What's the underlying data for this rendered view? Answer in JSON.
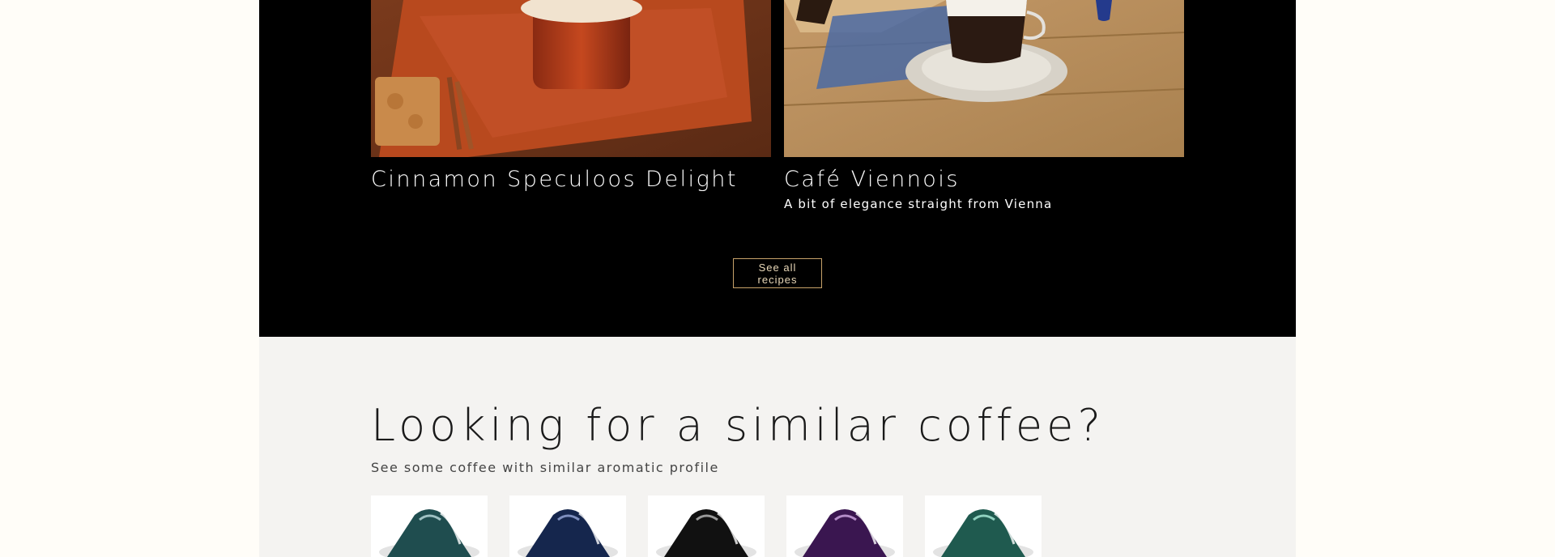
{
  "recipes": {
    "items": [
      {
        "title": "Cinnamon Speculoos Delight",
        "subtitle": ""
      },
      {
        "title": "Café Viennois",
        "subtitle": "A bit of elegance straight from Vienna"
      }
    ],
    "see_all_label": "See all recipes"
  },
  "similar": {
    "heading": "Looking for a similar coffee?",
    "subheading": "See some coffee with similar aromatic profile",
    "capsules": [
      {
        "icon": "capsule-icon",
        "color": "#1f4d4f"
      },
      {
        "icon": "capsule-icon",
        "color": "#15264d"
      },
      {
        "icon": "capsule-icon",
        "color": "#111111"
      },
      {
        "icon": "capsule-icon",
        "color": "#3a1650"
      },
      {
        "icon": "capsule-icon",
        "color": "#1f5a4f"
      }
    ]
  },
  "colors": {
    "accent": "#c7a26a",
    "dark_section": "#000000",
    "light_section": "#f4f3f1"
  }
}
